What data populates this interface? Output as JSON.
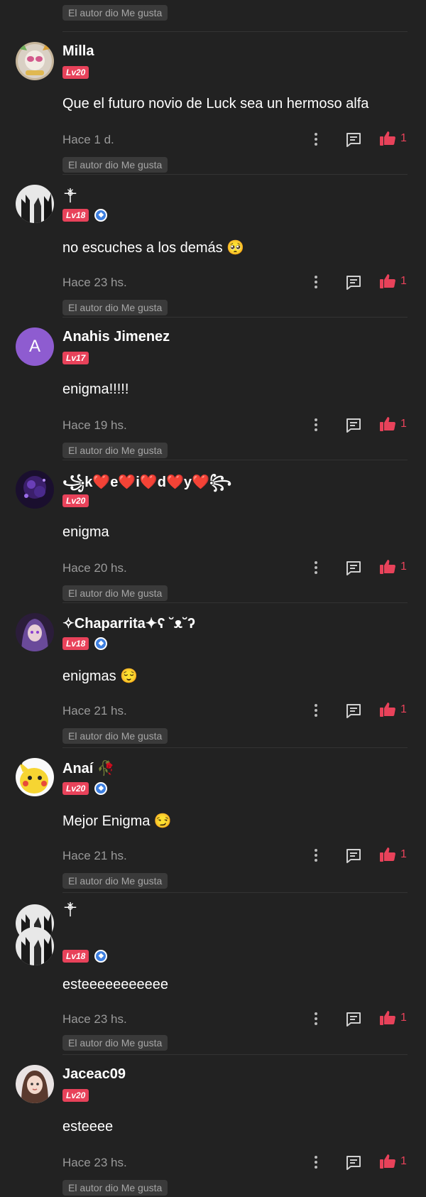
{
  "author_liked": "El autor dio Me gusta",
  "colors": {
    "background": "#222222",
    "accent": "#e8425a",
    "muted": "#9a9a9a",
    "verified": "#3d7fe0"
  },
  "comments": [
    {
      "username": "Milla",
      "level": "Lv20",
      "verified": false,
      "text": "Que el futuro novio de Luck sea un hermoso alfa",
      "time": "Hace 1 d.",
      "likes": "1",
      "avatar": "pink-glasses-avatar"
    },
    {
      "username": "",
      "level": "Lv18",
      "verified": true,
      "text": "no escuches a los demás 🥺",
      "time": "Hace 23 hs.",
      "likes": "1",
      "avatar": "white-forest-avatar"
    },
    {
      "username": "Anahis Jimenez",
      "level": "Lv17",
      "verified": false,
      "text": "enigma!!!!!",
      "time": "Hace 19 hs.",
      "likes": "1",
      "avatar": "letter-avatar",
      "avatar_letter": "A"
    },
    {
      "username": "꧁k❤️e❤️i❤️d❤️y❤️꧂",
      "level": "Lv20",
      "verified": false,
      "text": "enigma",
      "time": "Hace 20 hs.",
      "likes": "1",
      "avatar": "dark-purple-avatar"
    },
    {
      "username": "✧Chaparrita✦ʕ ˘ᴥ˘ʔ",
      "level": "Lv18",
      "verified": true,
      "text": "enigmas 😌",
      "time": "Hace 21 hs.",
      "likes": "1",
      "avatar": "anime-girl-avatar"
    },
    {
      "username": "Anaí 🥀",
      "level": "Lv20",
      "verified": true,
      "text": "Mejor Enigma 😏",
      "time": "Hace 21 hs.",
      "likes": "1",
      "avatar": "pikachu-avatar"
    },
    {
      "username": "",
      "level": "Lv18",
      "verified": true,
      "text": "esteeeeeeeeeee",
      "time": "Hace 23 hs.",
      "likes": "1",
      "avatar": "white-forest-avatar"
    },
    {
      "username": "Jaceac09",
      "level": "Lv20",
      "verified": false,
      "text": "esteeee",
      "time": "Hace 23 hs.",
      "likes": "1",
      "avatar": "girl-avatar"
    }
  ]
}
